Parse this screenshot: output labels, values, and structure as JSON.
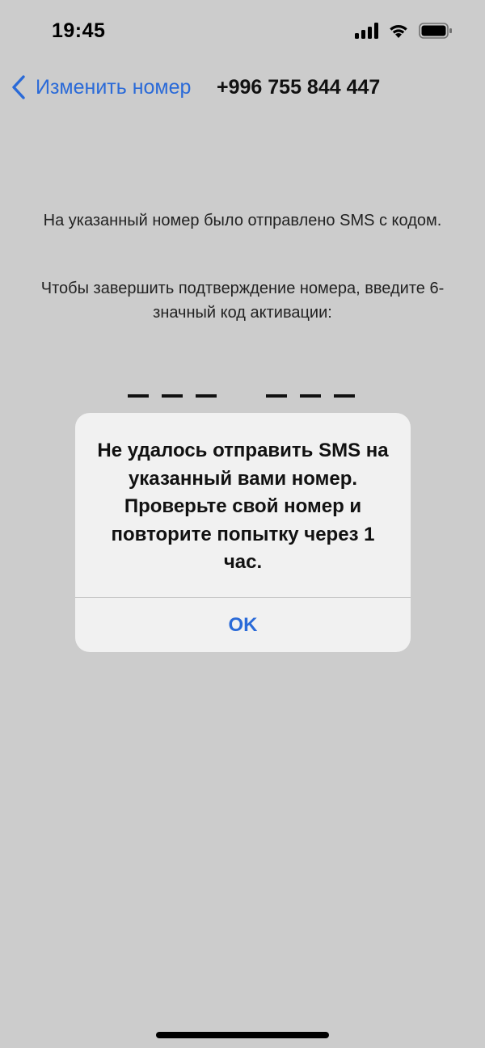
{
  "status_bar": {
    "time": "19:45"
  },
  "nav": {
    "back_label": "Изменить номер",
    "title": "+996 755 844 447"
  },
  "content": {
    "sms_sent_text": "На указанный номер было отправлено SMS с кодом.",
    "enter_code_text": "Чтобы завершить подтверждение номера, введите 6-значный код активации:"
  },
  "alert": {
    "message": "Не удалось отправить SMS на указанный вами номер. Проверьте свой номер и повторите попытку через 1 час.",
    "ok_label": "OK"
  },
  "colors": {
    "accent": "#2a6ad8",
    "background": "#cccccc",
    "alert_background": "#f1f1f1"
  },
  "icons": {
    "back": "chevron-left-icon",
    "signal": "cellular-signal-icon",
    "wifi": "wifi-icon",
    "battery": "battery-icon"
  }
}
